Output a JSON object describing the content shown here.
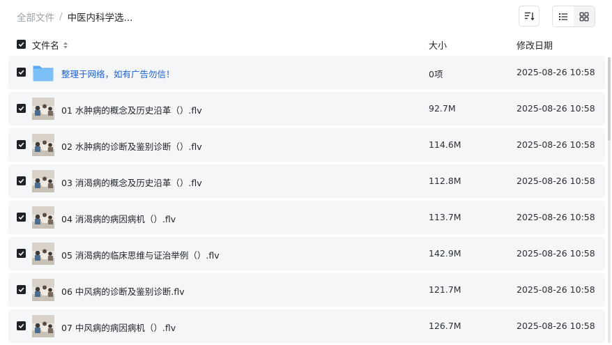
{
  "breadcrumb": {
    "root": "全部文件",
    "separator": "/",
    "current": "中医内科学选..."
  },
  "columns": {
    "name": "文件名",
    "size": "大小",
    "date": "修改日期"
  },
  "files": [
    {
      "type": "folder",
      "name": "整理于网络，如有广告勿信！",
      "size": "0项",
      "date": "2025-08-26 10:58",
      "checked": true
    },
    {
      "type": "video",
      "name": "01 水肿病的概念及历史沿革（）.flv",
      "size": "92.7M",
      "date": "2025-08-26 10:58",
      "checked": true
    },
    {
      "type": "video",
      "name": "02 水肿病的诊断及鉴别诊断（）.flv",
      "size": "114.6M",
      "date": "2025-08-26 10:58",
      "checked": true
    },
    {
      "type": "video",
      "name": "03 消渴病的概念及历史沿革（）.flv",
      "size": "112.8M",
      "date": "2025-08-26 10:58",
      "checked": true
    },
    {
      "type": "video",
      "name": "04 消渴病的病因病机（）.flv",
      "size": "113.7M",
      "date": "2025-08-26 10:58",
      "checked": true
    },
    {
      "type": "video",
      "name": "05 消渴病的临床思维与证治举例（）.flv",
      "size": "142.9M",
      "date": "2025-08-26 10:58",
      "checked": true
    },
    {
      "type": "video",
      "name": "06 中风病的诊断及鉴别诊断.flv",
      "size": "121.7M",
      "date": "2025-08-26 10:58",
      "checked": true
    },
    {
      "type": "video",
      "name": "07 中风病的病因病机（）.flv",
      "size": "126.7M",
      "date": "2025-08-26 10:58",
      "checked": true
    }
  ],
  "icons": {
    "sort": "sort-icon",
    "list_view": "list-view-icon",
    "grid_view": "grid-view-icon",
    "folder": "folder-icon",
    "checkbox": "checkbox-checked-icon"
  },
  "colors": {
    "folder_link": "#1a5fd6",
    "row_background": "#f5f6f7",
    "checkbox": "#1f2329"
  }
}
